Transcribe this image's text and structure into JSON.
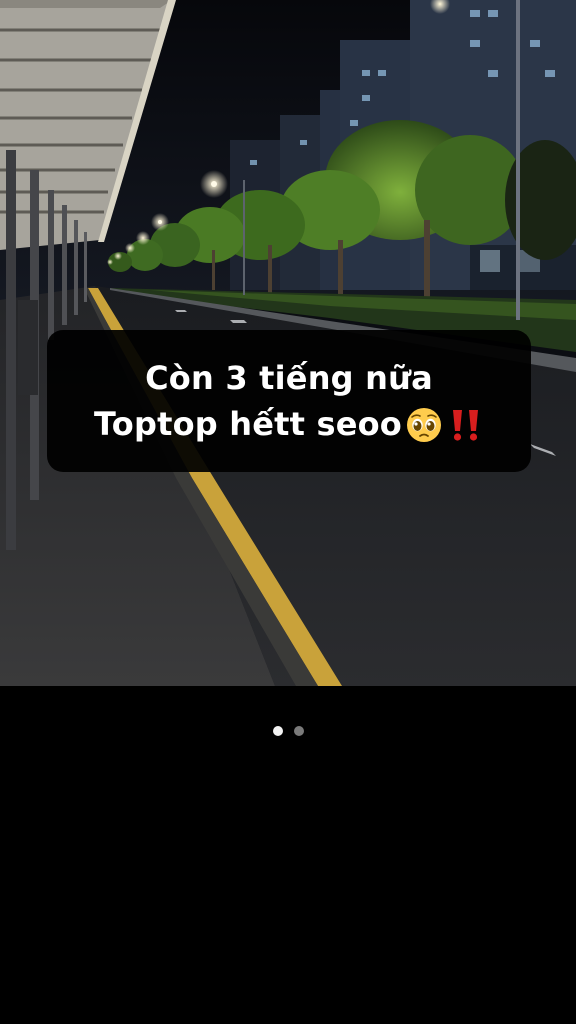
{
  "caption": {
    "line1": "Còn 3 tiếng nữa",
    "line2": "Toptop hếtt seoo"
  },
  "emoji": {
    "face": "pleading-face-icon",
    "bangs": "double-exclamation-icon"
  },
  "carousel": {
    "page_count": 2,
    "active_index": 0,
    "dot_1_label": "Slide 1",
    "dot_2_label": "Slide 2"
  },
  "colors": {
    "caption_background": "#000000",
    "caption_text": "#ffffff",
    "dot_active": "#f2f2f2",
    "dot_inactive": "#7a7a7a",
    "road_line": "#c9a23a"
  }
}
